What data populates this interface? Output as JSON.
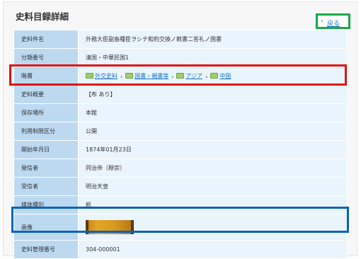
{
  "page_title": "史料目録詳細",
  "back_link": {
    "chevron": "›",
    "label": "戻る"
  },
  "rows": [
    {
      "label": "史料件名",
      "value": "外務大臣副島種臣ヲシテ和約交換ノ敕書二答礼ノ国書"
    },
    {
      "label": "分類番号",
      "value": "清国・中華民国1"
    },
    {
      "label": "階層",
      "breadcrumb": [
        "外交史料",
        "国書・親書等",
        "アジア",
        "中国"
      ]
    },
    {
      "label": "史料概要",
      "value": "【布 あり】"
    },
    {
      "label": "保存場所",
      "value": "本館"
    },
    {
      "label": "利用制限区分",
      "value": "公開"
    },
    {
      "label": "開始年月日",
      "value": "1874年01月23日"
    },
    {
      "label": "発信者",
      "value": "同治帝（穆宗）"
    },
    {
      "label": "受信者",
      "value": "明治天皇"
    },
    {
      "label": "媒体種別",
      "value": "紙"
    },
    {
      "label": "画像",
      "image": "document-thumbnail"
    },
    {
      "label": "史料管理番号",
      "value": "304-000001"
    }
  ],
  "colors": {
    "header_cell": "#bcd9f0",
    "value_cell": "#e9f4fc",
    "link": "#1a73c8",
    "highlight_red": "#e01010",
    "highlight_green": "#1aa84a",
    "highlight_blue": "#0b62b8"
  }
}
